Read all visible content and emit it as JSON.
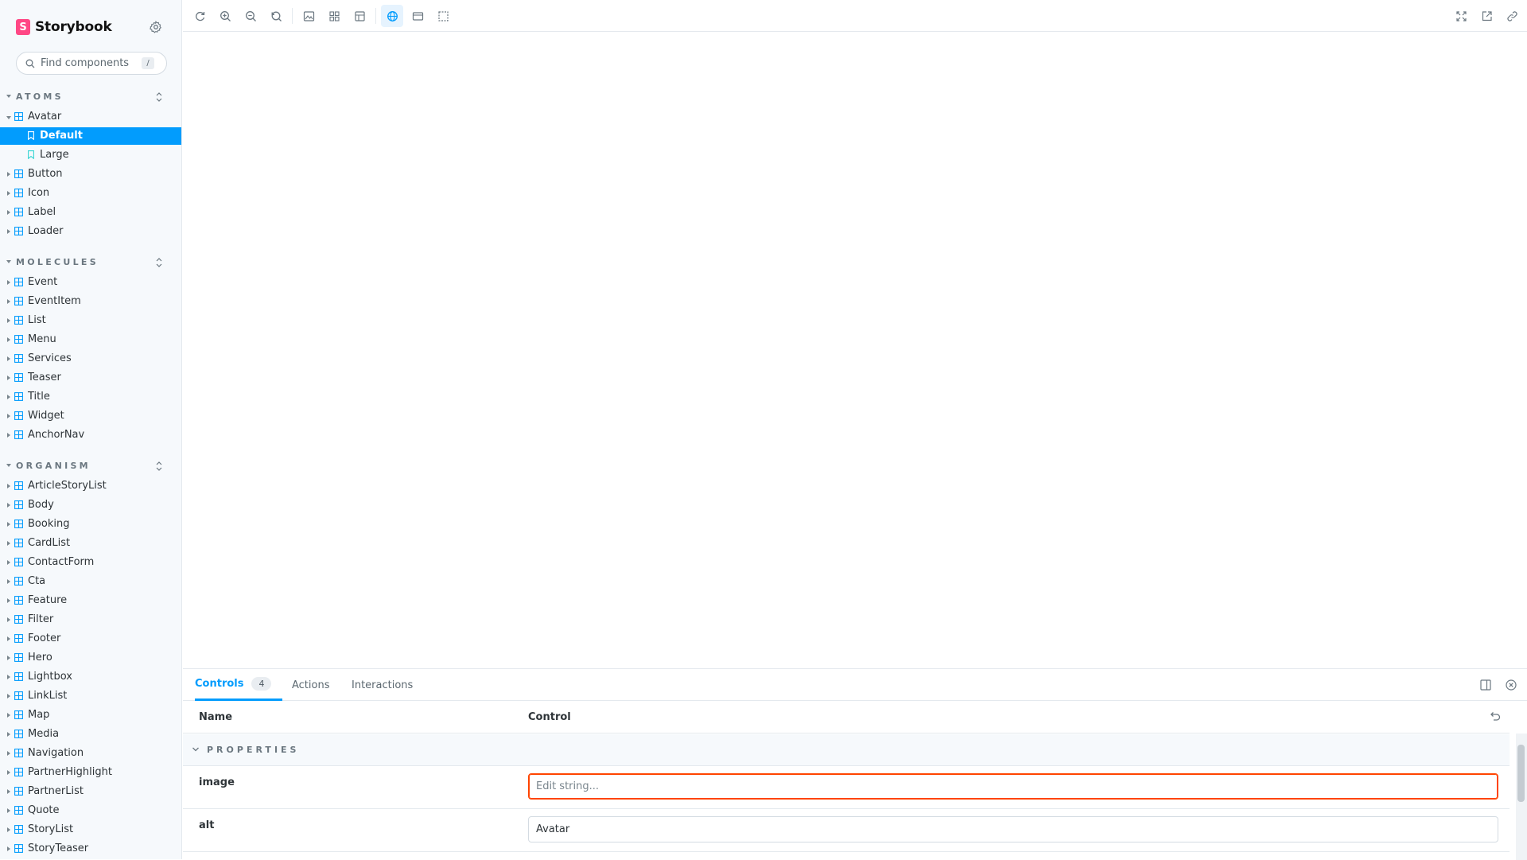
{
  "brand": {
    "name": "Storybook"
  },
  "search": {
    "placeholder": "Find components",
    "shortcut": "/"
  },
  "sections": {
    "atoms": {
      "title": "ATOMS",
      "items": [
        "Avatar",
        "Button",
        "Icon",
        "Label",
        "Loader"
      ],
      "avatar_stories": [
        "Default",
        "Large"
      ]
    },
    "molecules": {
      "title": "MOLECULES",
      "items": [
        "Event",
        "EventItem",
        "List",
        "Menu",
        "Services",
        "Teaser",
        "Title",
        "Widget",
        "AnchorNav"
      ]
    },
    "organism": {
      "title": "ORGANISM",
      "items": [
        "ArticleStoryList",
        "Body",
        "Booking",
        "CardList",
        "ContactForm",
        "Cta",
        "Feature",
        "Filter",
        "Footer",
        "Hero",
        "Lightbox",
        "LinkList",
        "Map",
        "Media",
        "Navigation",
        "PartnerHighlight",
        "PartnerList",
        "Quote",
        "StoryList",
        "StoryTeaser"
      ]
    }
  },
  "panel": {
    "tabs": [
      {
        "label": "Controls",
        "badge": "4"
      },
      {
        "label": "Actions"
      },
      {
        "label": "Interactions"
      }
    ],
    "headers": {
      "name": "Name",
      "control": "Control"
    },
    "group_title": "PROPERTIES",
    "rows": [
      {
        "name": "image",
        "value": "",
        "placeholder": "Edit string..."
      },
      {
        "name": "alt",
        "value": "Avatar",
        "placeholder": ""
      }
    ]
  },
  "colors": {
    "accent": "#029cfd",
    "brand": "#ff4785",
    "error": "#ff4400"
  },
  "icons": {
    "toolbar": [
      "reload-icon",
      "zoom-in-icon",
      "zoom-out-icon",
      "zoom-reset-icon",
      "background-icon",
      "grid-icon",
      "measure-icon",
      "globe-icon",
      "viewport-icon",
      "outline-icon",
      "fullscreen-icon",
      "open-new-tab-icon",
      "copy-link-icon"
    ]
  }
}
